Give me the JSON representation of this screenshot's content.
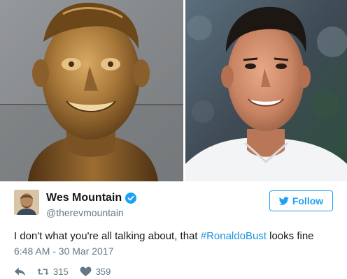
{
  "media": {
    "left_alt": "bronze bust",
    "right_alt": "footballer portrait"
  },
  "tweet": {
    "author_name": "Wes Mountain",
    "handle": "@therevmountain",
    "follow_label": "Follow",
    "text_before": "I don't what you're all talking about, that ",
    "hashtag": "#RonaldoBust",
    "text_after": " looks fine",
    "timestamp": "6:48 AM - 30 Mar 2017",
    "retweet_count": "315",
    "like_count": "359"
  },
  "icons": {
    "verified": "verified-badge-icon",
    "follow": "twitter-bird-icon",
    "reply": "reply-icon",
    "retweet": "retweet-icon",
    "like": "heart-icon"
  },
  "colors": {
    "brand_blue": "#1da1f2",
    "hashtag_blue": "#1b95e0",
    "muted": "#657786",
    "text": "#14171a",
    "bronze": "#a67a3d",
    "stone_wall": "#8e9193"
  }
}
